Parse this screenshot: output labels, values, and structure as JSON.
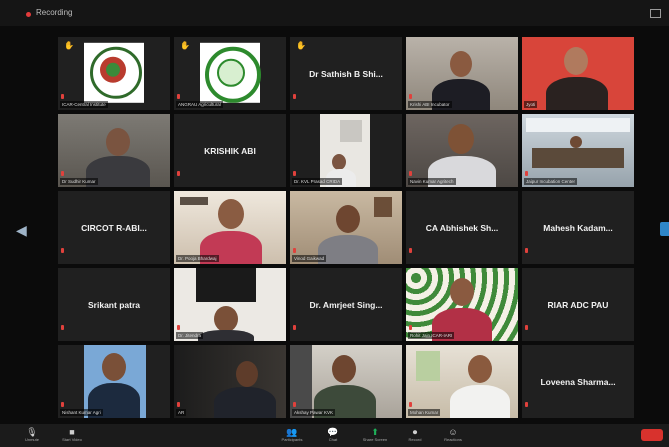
{
  "top_bar": {
    "status": "Recording"
  },
  "participants": [
    {
      "id": "p01",
      "name": "ICAR-Central Institute",
      "hand": true
    },
    {
      "id": "p02",
      "name": "ANGRAU Agricultural",
      "hand": true
    },
    {
      "id": "p03",
      "display": "Dr Sathish B Shi...",
      "hand": true
    },
    {
      "id": "p04",
      "name": "Krishi ABI Incubator"
    },
    {
      "id": "p05",
      "name": "Jyoti"
    },
    {
      "id": "p06",
      "name": "Dr Sudhir Kumar"
    },
    {
      "id": "p07",
      "display": "KRISHIK ABI"
    },
    {
      "id": "p08",
      "name": "Dr. KVL Prasad CRIDA"
    },
    {
      "id": "p09",
      "name": "Navin Kumar Agritech"
    },
    {
      "id": "p10",
      "name": "Jaipur Incubation Center"
    },
    {
      "id": "p11",
      "display": "CIRCOT R-ABI..."
    },
    {
      "id": "p12",
      "name": "Dr. Pooja Bhardwaj",
      "active": true
    },
    {
      "id": "p13",
      "name": "Vinod Gaikwad"
    },
    {
      "id": "p14",
      "display": "CA Abhishek Sh..."
    },
    {
      "id": "p15",
      "display": "Mahesh Kadam..."
    },
    {
      "id": "p16",
      "display": "Srikant patra"
    },
    {
      "id": "p17",
      "name": "Dr. Jitendra"
    },
    {
      "id": "p18",
      "display": "Dr. Amrjeet Sing..."
    },
    {
      "id": "p19",
      "name": "Rohit Jain ICAR-IARI"
    },
    {
      "id": "p20",
      "display": "RIAR ADC PAU"
    },
    {
      "id": "p21",
      "name": "Nishant Kumar Agri"
    },
    {
      "id": "p22",
      "name": "AR"
    },
    {
      "id": "p23",
      "name": "Akshay Pawar KVK"
    },
    {
      "id": "p24",
      "name": "Mohan Kumar"
    },
    {
      "id": "p25",
      "display": "Loveena Sharma..."
    }
  ],
  "toolbar": {
    "items": [
      {
        "label": "Unmute",
        "icon": "mic-icon"
      },
      {
        "label": "Start Video",
        "icon": "video-icon"
      },
      {
        "label": "Participants",
        "icon": "participants-icon"
      },
      {
        "label": "Chat",
        "icon": "chat-icon"
      },
      {
        "label": "Share Screen",
        "icon": "share-screen-icon"
      },
      {
        "label": "Record",
        "icon": "record-icon"
      },
      {
        "label": "Reactions",
        "icon": "reactions-icon"
      }
    ],
    "end_label": ""
  },
  "colors": {
    "active_speaker": "#c7e53a",
    "muted": "#e0413c",
    "share": "#1fb15a",
    "end": "#d8322d"
  }
}
